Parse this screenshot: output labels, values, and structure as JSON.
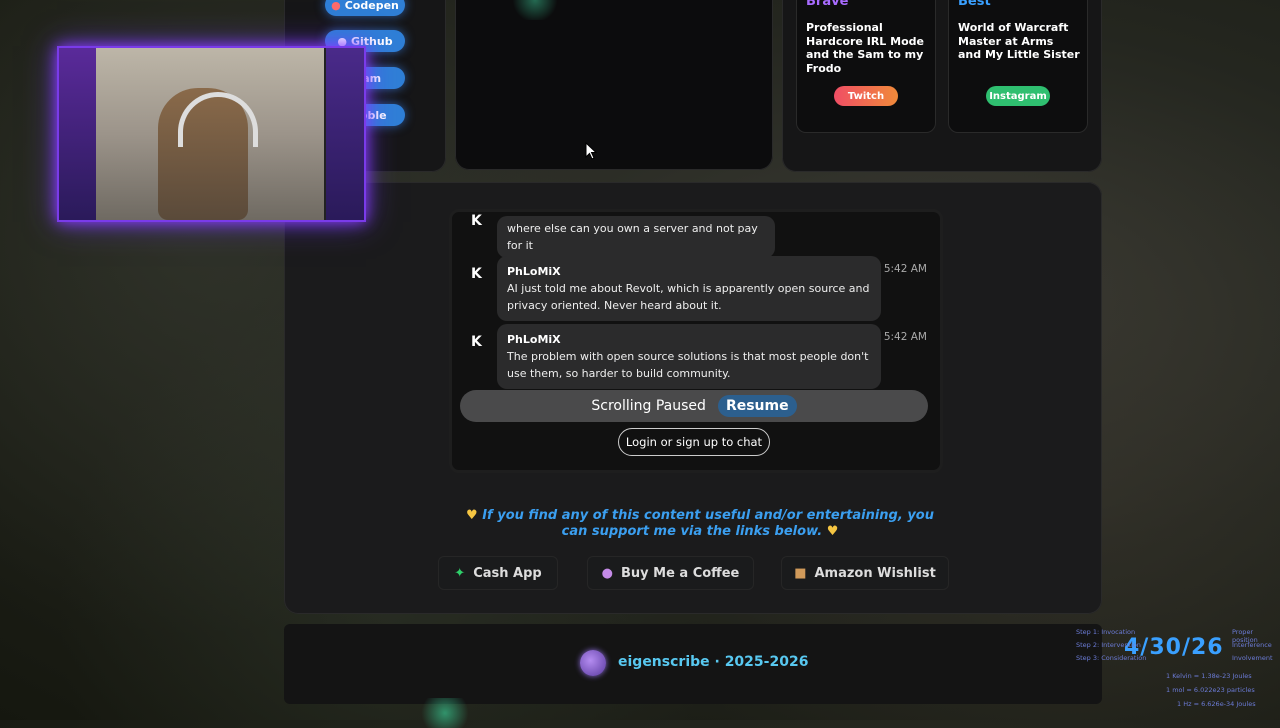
{
  "social_links": [
    "Codepen",
    "Github",
    "gram",
    "Bubble"
  ],
  "cards": [
    {
      "title": "Brave",
      "desc": "Professional Hardcore IRL Mode and the Sam to my Frodo",
      "button": "Twitch",
      "btn_color": "#f05a55"
    },
    {
      "title": "Best",
      "desc": "World of Warcraft Master at Arms and My Little Sister",
      "button": "Instagram",
      "btn_color": "#2fbf70"
    }
  ],
  "chat": {
    "messages": [
      {
        "name": "",
        "text": "where else can you own a server and not pay for it",
        "time": ""
      },
      {
        "name": "PhLoMiX",
        "text": "AI just told me about Revolt, which is apparently open source and privacy oriented. Never heard about it.",
        "time": "5:42 AM"
      },
      {
        "name": "PhLoMiX",
        "text": "The problem with open source solutions is that most people don't use them, so harder to build community.",
        "time": "5:42 AM"
      }
    ],
    "scrolling_paused": "Scrolling Paused",
    "resume": "Resume",
    "login": "Login or sign up to chat"
  },
  "support": {
    "text": "If you find any of this content useful and/or entertaining, you can support me via the links below.",
    "buttons": [
      "Cash App",
      "Buy Me a Coffee",
      "Amazon Wishlist"
    ]
  },
  "footer": {
    "text": "eigenscribe · 2025-2026"
  },
  "hud": {
    "date": "4/30/26",
    "lines_left": [
      "Step 1: Invocation",
      "Step 2: Intervention",
      "Step 3: Consideration"
    ],
    "lines_right": [
      "Proper position",
      "Interference",
      "Involvement"
    ],
    "lines_bottom": [
      "1 Kelvin = 1.38e-23 Joules",
      "1 mol = 6.022e23 particles",
      "1 Hz = 6.626e-34 Joules"
    ]
  },
  "colors": {
    "accent": "#3b9ff0",
    "webcam_glow": "#8a3bff"
  }
}
